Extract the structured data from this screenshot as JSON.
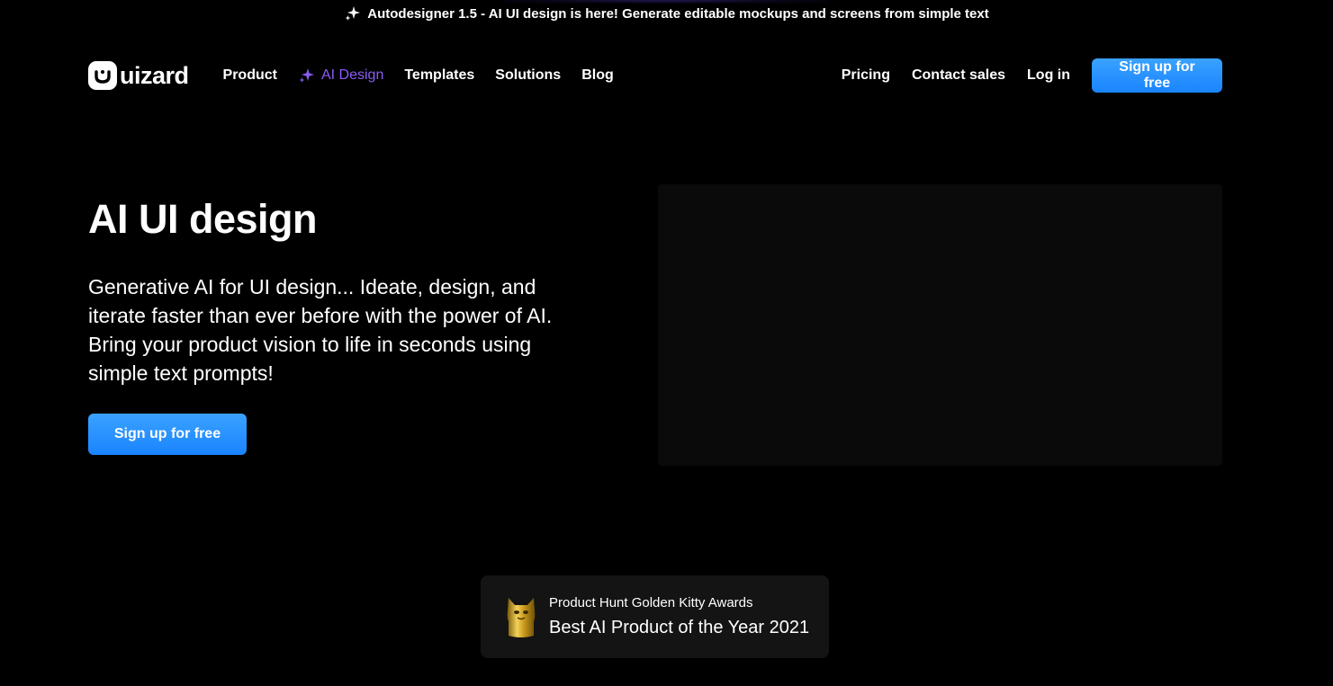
{
  "announcement": {
    "icon": "sparkle-icon",
    "text": "Autodesigner 1.5 - AI UI design is here! Generate editable mockups and screens from simple text"
  },
  "nav": {
    "logo_text": "uizard",
    "links": [
      {
        "label": "Product"
      },
      {
        "label": "AI Design",
        "icon": "sparkle-icon",
        "color": "#8a5cf6"
      },
      {
        "label": "Templates"
      },
      {
        "label": "Solutions"
      },
      {
        "label": "Blog"
      }
    ],
    "right_links": [
      {
        "label": "Pricing"
      },
      {
        "label": "Contact sales"
      },
      {
        "label": "Log in"
      }
    ],
    "signup_label": "Sign up for free"
  },
  "hero": {
    "title": "AI UI design",
    "subtitle": "Generative AI for UI design... Ideate, design, and iterate faster than ever before with the power of AI. Bring your product vision to life in seconds using simple text prompts!",
    "cta_label": "Sign up for free"
  },
  "award": {
    "icon": "golden-kitty-icon",
    "top_line": "Product Hunt Golden Kitty Awards",
    "main_line": "Best AI Product of the Year 2021"
  },
  "colors": {
    "background": "#000000",
    "accent_blue": "#1a84ff",
    "accent_purple": "#8a5cf6",
    "card_bg": "#141414"
  }
}
